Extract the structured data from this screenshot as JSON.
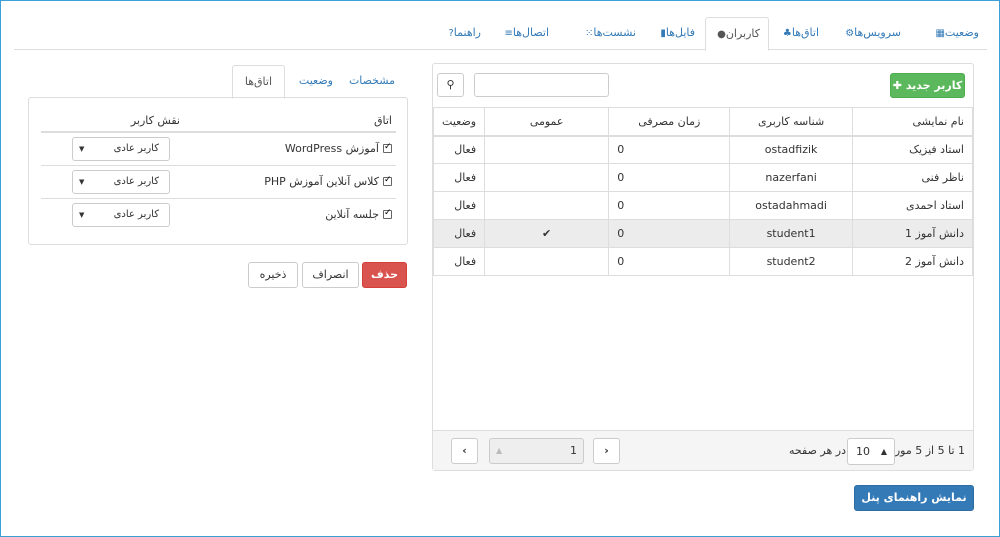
{
  "top_tabs": [
    {
      "label": "وضعیت",
      "icon": "chart-icon"
    },
    {
      "label": "سرویس‌ها",
      "icon": "gear-icon"
    },
    {
      "label": "اتاق‌ها",
      "icon": "sitemap-icon"
    },
    {
      "label": "کاربران",
      "icon": "user-icon"
    },
    {
      "label": "فایل‌ها",
      "icon": "file-icon"
    },
    {
      "label": "نشست‌ها",
      "icon": "grid-icon"
    },
    {
      "label": "اتصال‌ها",
      "icon": "list-icon"
    },
    {
      "label": "راهنما",
      "icon": "question-icon"
    }
  ],
  "users": {
    "new_button": "کاربر جدید",
    "search_placeholder": "",
    "columns": [
      "نام نمایشی",
      "شناسه کاربری",
      "زمان مصرفی",
      "عمومی",
      "وضعیت"
    ],
    "rows": [
      {
        "name": "استاد فیزیک",
        "id": "ostadfizik",
        "time": "0",
        "public": "",
        "status": "فعال"
      },
      {
        "name": "ناظر فنی",
        "id": "nazerfani",
        "time": "0",
        "public": "",
        "status": "فعال"
      },
      {
        "name": "استاد احمدی",
        "id": "ostadahmadi",
        "time": "0",
        "public": "",
        "status": "فعال"
      },
      {
        "name": "دانش آموز 1",
        "id": "student1",
        "time": "0",
        "public": "✔",
        "status": "فعال"
      },
      {
        "name": "دانش آموز 2",
        "id": "student2",
        "time": "0",
        "public": "",
        "status": "فعال"
      }
    ],
    "pager_text": "1 تا 5 از 5 مورد",
    "page_size": "10",
    "per_page_label": "در هر صفحه",
    "page_input": "1"
  },
  "guide_button": "نمایش راهنمای پنل",
  "detail": {
    "tabs": [
      "مشخصات",
      "وضعیت",
      "اتاق‌ها"
    ],
    "col_room": "اتاق",
    "col_role": "نقش کاربر",
    "rooms": [
      {
        "name": "آموزش WordPress",
        "role": "کاربر عادی"
      },
      {
        "name": "کلاس آنلاین آموزش PHP",
        "role": "کاربر عادی"
      },
      {
        "name": "جلسه آنلاین",
        "role": "کاربر عادی"
      }
    ],
    "delete": "حذف",
    "cancel": "انصراف",
    "save": "ذخیره"
  },
  "colors": {
    "accent": "#337ab7",
    "success": "#5cb85c",
    "danger": "#d9534f",
    "frame": "#3aa0d8"
  }
}
